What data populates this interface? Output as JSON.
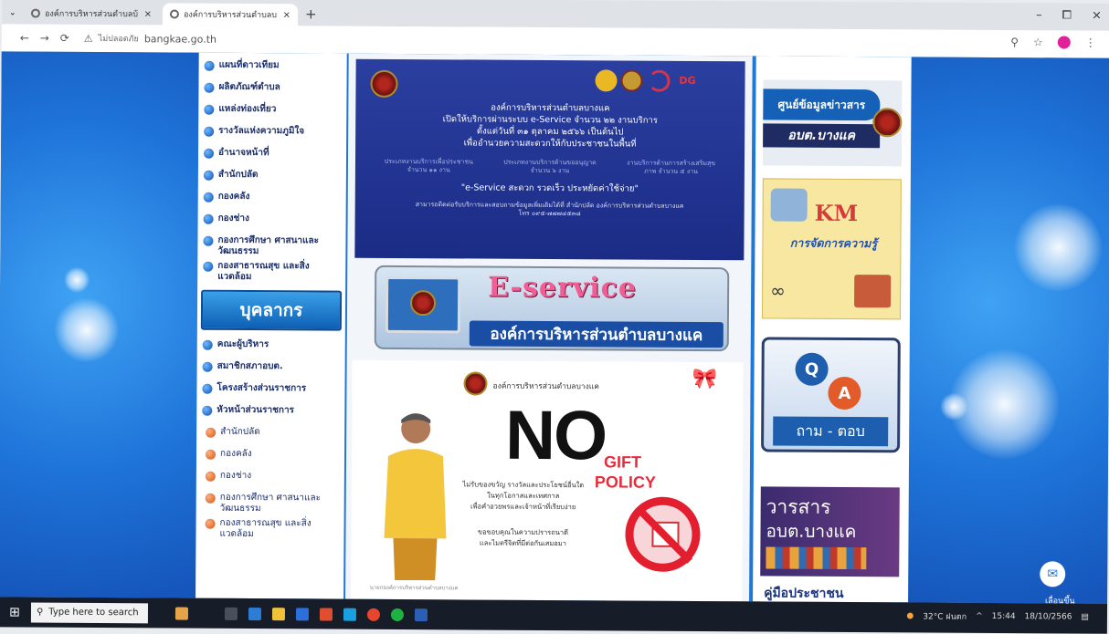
{
  "browser": {
    "tabs": [
      {
        "title": "องค์การบริหารส่วนตำบลบ้านกลาง",
        "close": "×"
      },
      {
        "title": "องค์การบริหารส่วนตำบลบางแค จังห",
        "close": "×"
      }
    ],
    "tab_menu": "⌄",
    "new_tab": "+",
    "window_controls": {
      "minimize": "–",
      "maximize": "⧠",
      "close": "×"
    },
    "nav": {
      "back": "←",
      "forward": "→",
      "reload": "⟳"
    },
    "address": {
      "security_icon": "warning-icon",
      "security_text": "ไม่ปลอดภัย",
      "url": "bangkae.go.th"
    },
    "toolbar_icons": {
      "zoom": "⚲",
      "star": "☆",
      "menu": "⋮"
    }
  },
  "left_nav": {
    "items": [
      "แผนที่ดาวเทียม",
      "ผลิตภัณฑ์ตำบล",
      "แหล่งท่องเที่ยว",
      "รางวัลแห่งความภูมิใจ",
      "อำนาจหน้าที่",
      "สำนักปลัด",
      "กองคลัง",
      "กองช่าง",
      "กองการศึกษา ศาสนาและวัฒนธรรม",
      "กองสาธารณสุข และสิ่งแวดล้อม"
    ],
    "personnel_banner": "บุคลากร",
    "personnel_items": [
      "คณะผู้บริหาร",
      "สมาชิกสภาอบต.",
      "โครงสร้างส่วนราชการ",
      "หัวหน้าส่วนราชการ"
    ],
    "sub_items": [
      "สำนักปลัด",
      "กองคลัง",
      "กองช่าง",
      "กองการศึกษา ศาสนาและวัฒนธรรม",
      "กองสาธารณสุข และสิ่งแวดล้อม"
    ]
  },
  "banner": {
    "logo_dg": "DG",
    "line1": "องค์การบริหารส่วนตำบลบางแค",
    "line2": "เปิดให้บริการผ่านระบบ e-Service จำนวน ๒๒ งานบริการ",
    "line3": "ตั้งแต่วันที่ ๓๑ ตุลาคม ๒๕๖๖ เป็นต้นไป",
    "line4": "เพื่ออำนวยความสะดวกให้กับประชาชนในพื้นที่",
    "col1": "ประเภทงานบริการเพื่อประชาชน จำนวน ๑๑ งาน",
    "col2": "ประเภทงานบริการด้านขออนุญาต จำนวน ๖ งาน",
    "col3": "งานบริการด้านการสร้างเสริมสุขภาพ จำนวน ๕ งาน",
    "slogan": "\"e-Service สะดวก รวดเร็ว ประหยัดค่าใช้จ่าย\"",
    "contact": "สามารถติดต่อรับบริการและสอบถามข้อมูลเพิ่มเติมได้ที่ สำนักปลัด องค์การบริหารส่วนตำบลบางแค",
    "phone": "โทร ๐๙๕-๗๗๗๔๕๓๘"
  },
  "eservice": {
    "title": "E-service",
    "subtitle": "องค์การบริหารส่วนตำบลบางแค"
  },
  "no_gift": {
    "org": "องค์การบริหารส่วนตำบลบางแค",
    "no": "NO",
    "gift": "GIFT",
    "policy": "POLICY",
    "text1": "ไม่รับของขวัญ รางวัลและประโยชน์อื่นใด",
    "text2": "ในทุกโอกาสและเทศกาล",
    "text3": "เพื่อคำอวยพรและเจ้าหน้าที่เรียบง่าย",
    "text4": "ขอขอบคุณในความปรารถนาดี",
    "text5": "และไมตรีจิตที่มีต่อกันเสมอมา",
    "caption": "นายกองค์การบริหารส่วนตำบลบางแค"
  },
  "right_col": {
    "info_center_top": "ศูนย์ข้อมูลข่าวสาร",
    "info_center_bottom": "อบต.บางแค",
    "km_title": "KM",
    "km_sub": "การจัดการความรู้",
    "qa_q": "Q",
    "qa_a": "A",
    "qa_label": "ถาม - ตอบ",
    "journal_1": "วารสาร",
    "journal_2": "อบต.บางแค",
    "handbook": "คู่มือประชาชน"
  },
  "chat": {
    "label": "เลื่อนขึ้น"
  },
  "taskbar": {
    "search_placeholder": "Type here to search",
    "weather": "32°C ฝนตก",
    "time": "15:44",
    "date": "18/10/2566"
  },
  "colors": {
    "page_bg": "#1f77d6",
    "banner_bg": "#2b3fa0",
    "nav_text": "#1a2f6e",
    "accent_red": "#e52e3c",
    "eservice_pink": "#f35d93"
  }
}
